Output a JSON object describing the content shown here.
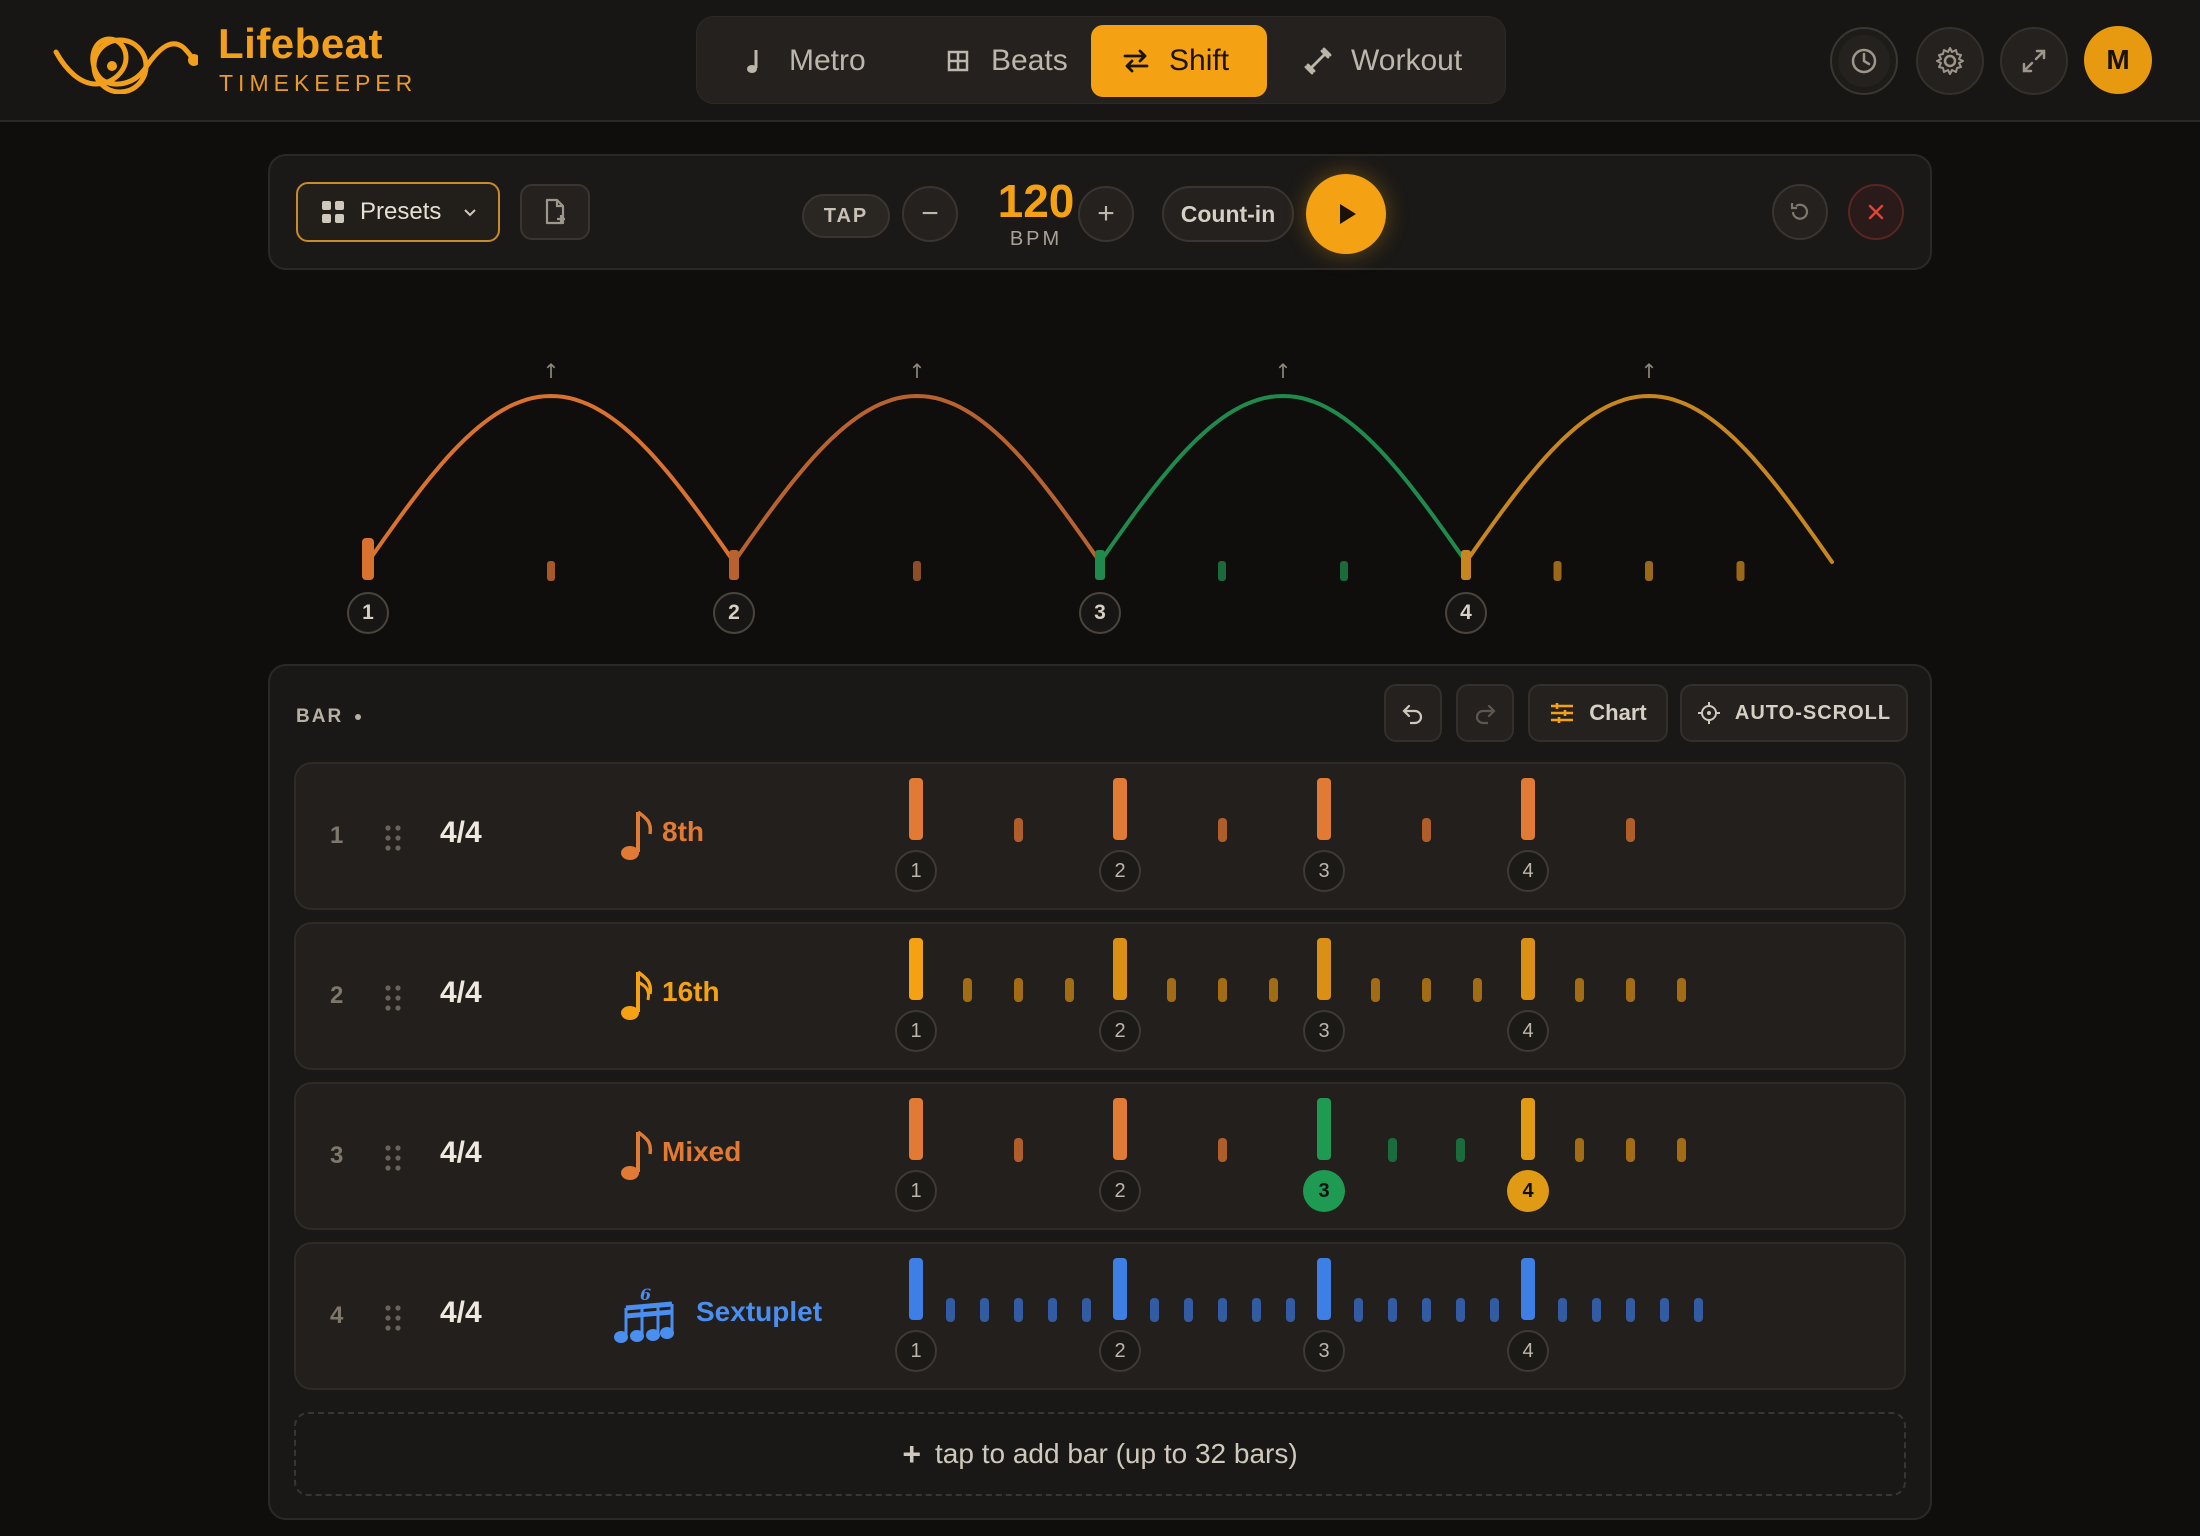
{
  "app": {
    "brand_name": "Lifebeat",
    "brand_sub": "TIMEKEEPER",
    "accent": "#f4a213"
  },
  "nav": [
    {
      "label": "Metro",
      "icon": "note-icon",
      "active": false
    },
    {
      "label": "Beats",
      "icon": "grid-icon",
      "active": false
    },
    {
      "label": "Shift",
      "icon": "swap-icon",
      "active": true
    },
    {
      "label": "Workout",
      "icon": "dumbbell-icon",
      "active": false
    }
  ],
  "header_actions": {
    "history_icon": "clock-icon",
    "settings_icon": "gear-icon",
    "fullscreen_icon": "expand-icon",
    "avatar_initial": "M"
  },
  "transport": {
    "presets_label": "Presets",
    "tap_label": "TAP",
    "minus_label": "−",
    "plus_label": "+",
    "bpm": "120",
    "bpm_unit": "BPM",
    "countin_label": "Count-in"
  },
  "wave": {
    "beat_labels": [
      "1",
      "2",
      "3",
      "4"
    ],
    "beat_colors": [
      "#d9722f",
      "#b8632f",
      "#1f8a4c",
      "#c8871e"
    ],
    "subdivisions_per_beat": [
      2,
      2,
      3,
      4
    ],
    "arrow_glyph": "↑"
  },
  "bars_panel": {
    "label": "BAR",
    "chart_label": "Chart",
    "autoscroll_label": "AUTO-SCROLL",
    "add_bar_label": "tap to add bar (up to 32 bars)",
    "add_bar_plus": "+"
  },
  "bars": [
    {
      "index": "1",
      "signature": "4/4",
      "name": "8th",
      "color": "#e07a35",
      "note_icon": "eighth-note-icon",
      "beats": [
        {
          "label": "1",
          "color": "#e07a35",
          "subs": 2,
          "sub_color": "#c96a2c",
          "highlight": false
        },
        {
          "label": "2",
          "color": "#e07a35",
          "subs": 2,
          "sub_color": "#c96a2c",
          "highlight": false
        },
        {
          "label": "3",
          "color": "#e07a35",
          "subs": 2,
          "sub_color": "#c96a2c",
          "highlight": false
        },
        {
          "label": "4",
          "color": "#e07a35",
          "subs": 2,
          "sub_color": "#c96a2c",
          "highlight": false
        }
      ]
    },
    {
      "index": "2",
      "signature": "4/4",
      "name": "16th",
      "color": "#f4a213",
      "note_icon": "sixteenth-note-icon",
      "beats": [
        {
          "label": "1",
          "color": "#f4a213",
          "subs": 4,
          "sub_color": "#b87a14",
          "highlight": false
        },
        {
          "label": "2",
          "color": "#d99014",
          "subs": 4,
          "sub_color": "#b87a14",
          "highlight": false
        },
        {
          "label": "3",
          "color": "#d99014",
          "subs": 4,
          "sub_color": "#b87a14",
          "highlight": false
        },
        {
          "label": "4",
          "color": "#d99014",
          "subs": 4,
          "sub_color": "#b87a14",
          "highlight": false
        }
      ]
    },
    {
      "index": "3",
      "signature": "4/4",
      "name": "Mixed",
      "color": "#e07a35",
      "note_icon": "eighth-note-icon",
      "beats": [
        {
          "label": "1",
          "color": "#e07a35",
          "subs": 2,
          "sub_color": "#c96a2c",
          "highlight": false
        },
        {
          "label": "2",
          "color": "#e07a35",
          "subs": 2,
          "sub_color": "#c96a2c",
          "highlight": false
        },
        {
          "label": "3",
          "color": "#1f9a52",
          "subs": 3,
          "sub_color": "#1a7a43",
          "highlight": true
        },
        {
          "label": "4",
          "color": "#e09a14",
          "subs": 4,
          "sub_color": "#b87a14",
          "highlight": true
        }
      ]
    },
    {
      "index": "4",
      "signature": "4/4",
      "name": "Sextuplet",
      "color": "#4a8ef0",
      "note_icon": "sextuplet-icon",
      "beats": [
        {
          "label": "1",
          "color": "#3e7fe6",
          "subs": 6,
          "sub_color": "#3566b8",
          "highlight": false
        },
        {
          "label": "2",
          "color": "#3e7fe6",
          "subs": 6,
          "sub_color": "#3566b8",
          "highlight": false
        },
        {
          "label": "3",
          "color": "#3e7fe6",
          "subs": 6,
          "sub_color": "#3566b8",
          "highlight": false
        },
        {
          "label": "4",
          "color": "#3e7fe6",
          "subs": 6,
          "sub_color": "#3566b8",
          "highlight": false
        }
      ]
    }
  ]
}
